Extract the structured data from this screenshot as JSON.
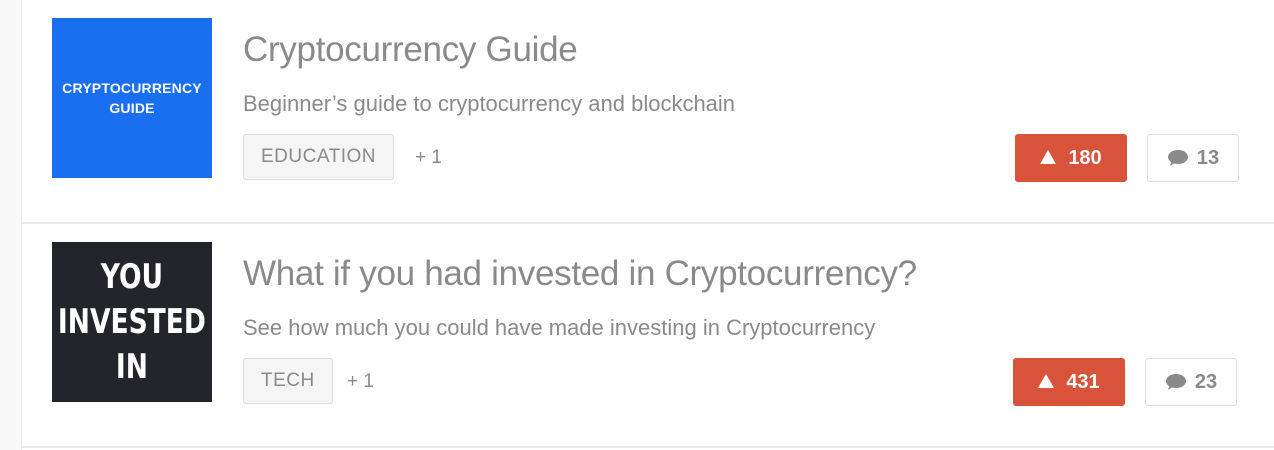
{
  "posts": [
    {
      "thumb_text": "CRYPTOCURRENCY\nGUIDE",
      "thumb_color": "#1a6ff0",
      "title": "Cryptocurrency Guide",
      "subtitle": "Beginner’s guide to cryptocurrency and blockchain",
      "tag": "EDUCATION",
      "more_tags": "+ 1",
      "votes": "180",
      "comments": "13"
    },
    {
      "thumb_text": "YOU\nINVESTED\nIN",
      "thumb_color": "#24242b",
      "title": "What if you had invested in Cryptocurrency?",
      "subtitle": "See how much you could have made investing in Cryptocurrency",
      "tag": "TECH",
      "more_tags": "+ 1",
      "votes": "431",
      "comments": "23"
    }
  ],
  "colors": {
    "upvote": "#d9533b",
    "text_muted": "#8a8a8a",
    "border": "#dcdcdc"
  },
  "icons": {
    "upvote": "upvote-triangle-icon",
    "comment": "comment-bubble-icon"
  }
}
